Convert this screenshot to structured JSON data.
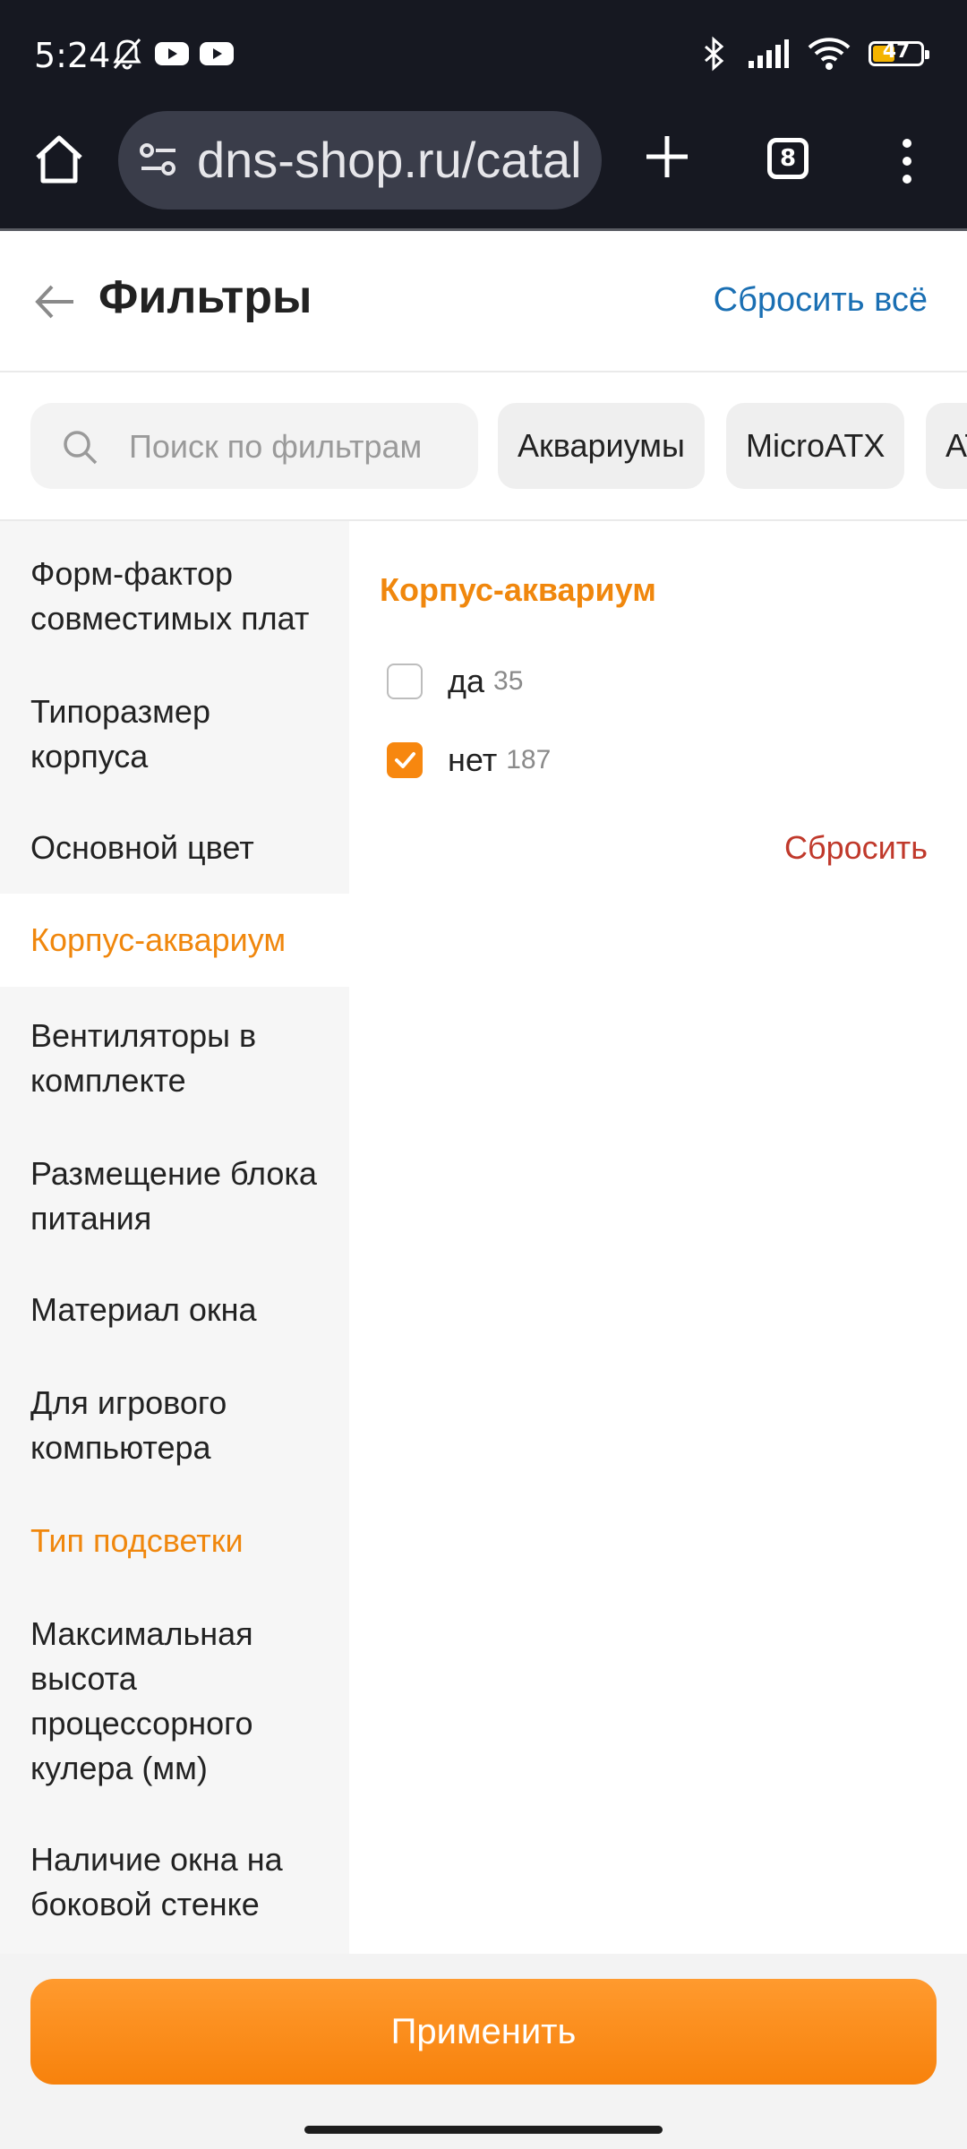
{
  "status_bar": {
    "time": "5:24",
    "battery": "47"
  },
  "browser": {
    "url": "dns-shop.ru/catal",
    "tab_count": "8"
  },
  "header": {
    "title": "Фильтры",
    "reset_all": "Сбросить всё"
  },
  "search": {
    "placeholder": "Поиск по фильтрам"
  },
  "chips": [
    "Аквариумы",
    "MicroATX",
    "AT"
  ],
  "sidebar": {
    "items": [
      "Форм-фактор совместимых плат",
      "Типоразмер корпуса",
      "Основной цвет",
      "Корпус-аквариум",
      "Вентиляторы в комплекте",
      "Размещение блока питания",
      "Материал окна",
      "Для игрового компьютера",
      "Тип подсветки",
      "Максимальная высота процессорного кулера (мм)",
      "Наличие окна на боковой стенке"
    ]
  },
  "filter": {
    "title": "Корпус-аквариум",
    "options": [
      {
        "label": "да",
        "count": "35",
        "checked": false
      },
      {
        "label": "нет",
        "count": "187",
        "checked": true
      }
    ],
    "reset": "Сбросить"
  },
  "footer": {
    "apply": "Применить"
  },
  "colors": {
    "accent": "#f7870f",
    "link": "#1a6fb3",
    "reset": "#c0392b",
    "dark_bar": "#161821"
  }
}
